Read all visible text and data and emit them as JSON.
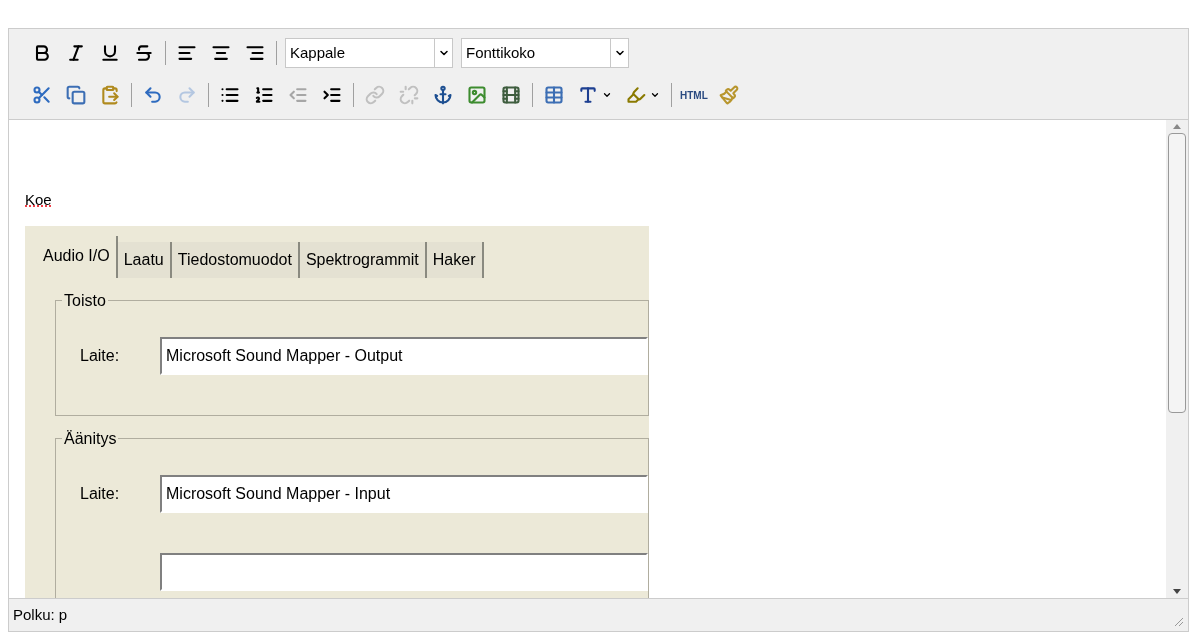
{
  "toolbar": {
    "rows": [
      [
        {
          "kind": "bold",
          "disabled": false
        },
        {
          "kind": "italic",
          "disabled": false
        },
        {
          "kind": "underline",
          "disabled": false
        },
        {
          "kind": "strike",
          "disabled": false
        },
        {
          "kind": "separator"
        },
        {
          "kind": "align-left",
          "disabled": false
        },
        {
          "kind": "align-center",
          "disabled": false
        },
        {
          "kind": "align-right",
          "disabled": false
        },
        {
          "kind": "separator"
        },
        {
          "kind": "select",
          "value": "Kappale"
        },
        {
          "kind": "select",
          "value": "Fonttikoko"
        }
      ],
      [
        {
          "kind": "cut",
          "disabled": false
        },
        {
          "kind": "copy",
          "disabled": false
        },
        {
          "kind": "paste",
          "disabled": false
        },
        {
          "kind": "separator"
        },
        {
          "kind": "undo",
          "disabled": false
        },
        {
          "kind": "redo",
          "disabled": true
        },
        {
          "kind": "separator"
        },
        {
          "kind": "bullets",
          "disabled": false
        },
        {
          "kind": "numbers",
          "disabled": false
        },
        {
          "kind": "outdent",
          "disabled": true
        },
        {
          "kind": "indent",
          "disabled": false
        },
        {
          "kind": "separator"
        },
        {
          "kind": "link",
          "disabled": true
        },
        {
          "kind": "unlink",
          "disabled": true
        },
        {
          "kind": "anchor",
          "disabled": false
        },
        {
          "kind": "image",
          "disabled": false
        },
        {
          "kind": "media",
          "disabled": false
        },
        {
          "kind": "separator"
        },
        {
          "kind": "table",
          "disabled": false
        },
        {
          "kind": "text-color",
          "disabled": false
        },
        {
          "kind": "highlight",
          "disabled": false
        },
        {
          "kind": "separator"
        },
        {
          "kind": "text",
          "label": "HTML",
          "disabled": false
        },
        {
          "kind": "cleanup",
          "disabled": false
        }
      ]
    ]
  },
  "content": {
    "paragraph": {
      "text": "Koe",
      "misspelled": true
    },
    "embedded_window": {
      "tabs": [
        {
          "label": "Audio I/O",
          "selected": true
        },
        {
          "label": "Laatu",
          "selected": false
        },
        {
          "label": "Tiedostomuodot",
          "selected": false
        },
        {
          "label": "Spektrogrammit",
          "selected": false
        },
        {
          "label": "Haker",
          "selected": false
        }
      ],
      "groups": [
        {
          "title": "Toisto",
          "fields": [
            {
              "kind": "field",
              "label": "Laite:",
              "value": "Microsoft Sound Mapper - Output"
            }
          ]
        },
        {
          "title": "Äänitys",
          "fields": [
            {
              "kind": "field",
              "label": "Laite:",
              "value": "Microsoft Sound Mapper - Input"
            },
            {
              "kind": "cut"
            }
          ]
        }
      ]
    }
  },
  "status_bar": {
    "path": "Polku: p"
  }
}
